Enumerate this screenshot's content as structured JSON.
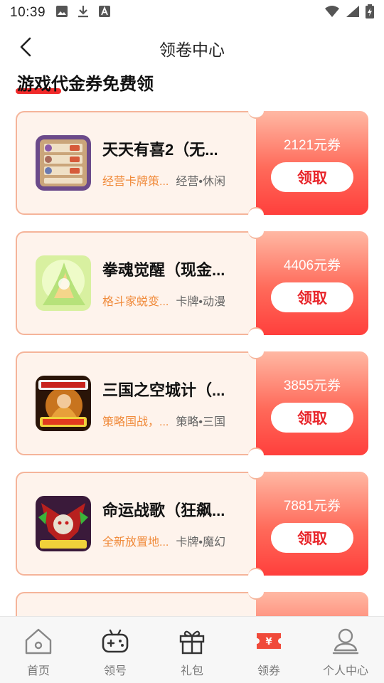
{
  "statusbar": {
    "time": "10:39"
  },
  "navbar": {
    "title": "领卷中心"
  },
  "section": {
    "title": "游戏代金券免费领"
  },
  "coupons": [
    {
      "name": "天天有喜2（无...",
      "desc": "经营卡牌策...",
      "tags": "经营•休闲",
      "amount": "2121元券",
      "button": "领取"
    },
    {
      "name": "拳魂觉醒（现金...",
      "desc": "格斗家蜕变...",
      "tags": "卡牌•动漫",
      "amount": "4406元券",
      "button": "领取"
    },
    {
      "name": "三国之空城计（...",
      "desc": "策略国战，...",
      "tags": "策略•三国",
      "amount": "3855元券",
      "button": "领取"
    },
    {
      "name": "命运战歌（狂飙...",
      "desc": "全新放置地...",
      "tags": "卡牌•魔幻",
      "amount": "7881元券",
      "button": "领取"
    }
  ],
  "tabbar": {
    "items": [
      {
        "label": "首页",
        "icon": "home-icon"
      },
      {
        "label": "领号",
        "icon": "gamepad-icon"
      },
      {
        "label": "礼包",
        "icon": "gift-icon"
      },
      {
        "label": "领券",
        "icon": "coupon-icon",
        "active": true
      },
      {
        "label": "个人中心",
        "icon": "user-icon"
      }
    ]
  },
  "colors": {
    "accent": "#ff3f3c",
    "card_border": "#f5b49a",
    "card_bg": "#fef3ec",
    "desc": "#f08a3a"
  }
}
